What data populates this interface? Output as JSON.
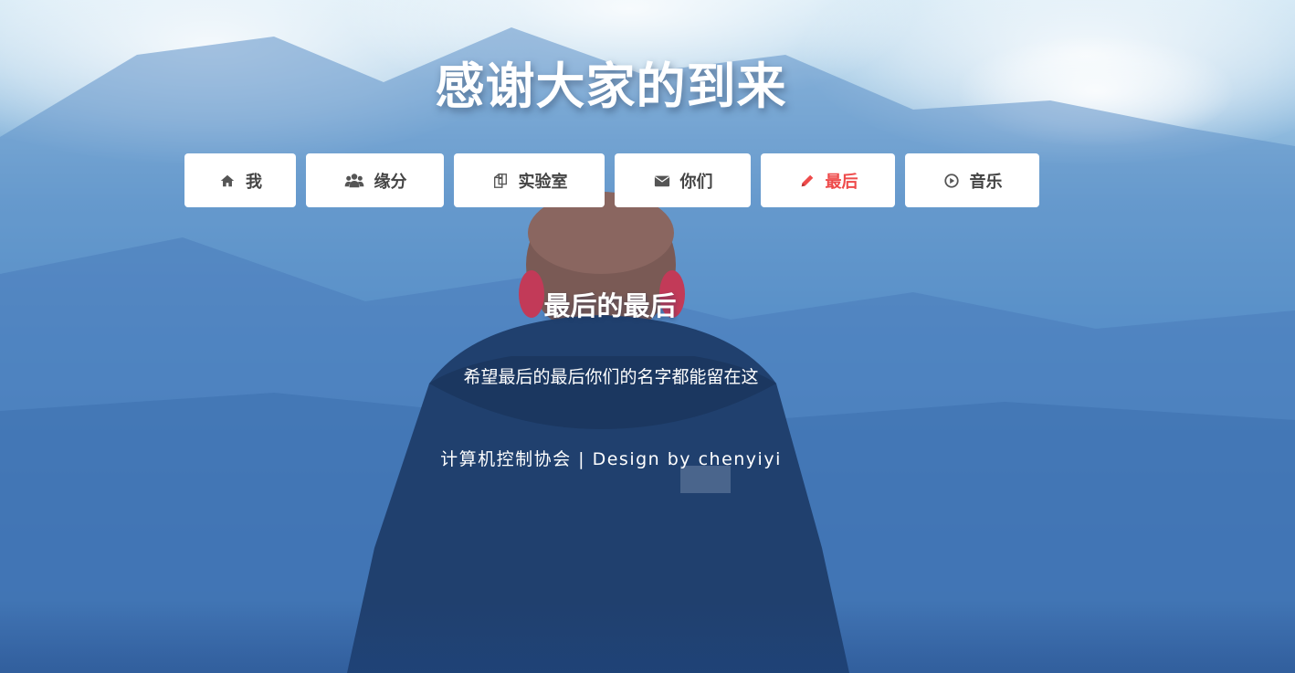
{
  "header": {
    "title": "感谢大家的到来"
  },
  "nav": {
    "items": [
      {
        "label": "我",
        "icon": "home-icon"
      },
      {
        "label": "缘分",
        "icon": "users-icon"
      },
      {
        "label": "实验室",
        "icon": "copy-icon"
      },
      {
        "label": "你们",
        "icon": "envelope-icon"
      },
      {
        "label": "最后",
        "icon": "pencil-icon",
        "active": true
      },
      {
        "label": "音乐",
        "icon": "play-circle-icon"
      }
    ],
    "text_color": "#444444",
    "active_color": "#ee4a4a"
  },
  "section": {
    "title": "最后的最后",
    "text": "希望最后的最后你们的名字都能留在这"
  },
  "footer": {
    "text": "计算机控制协会 | Design by chenyiyi"
  }
}
